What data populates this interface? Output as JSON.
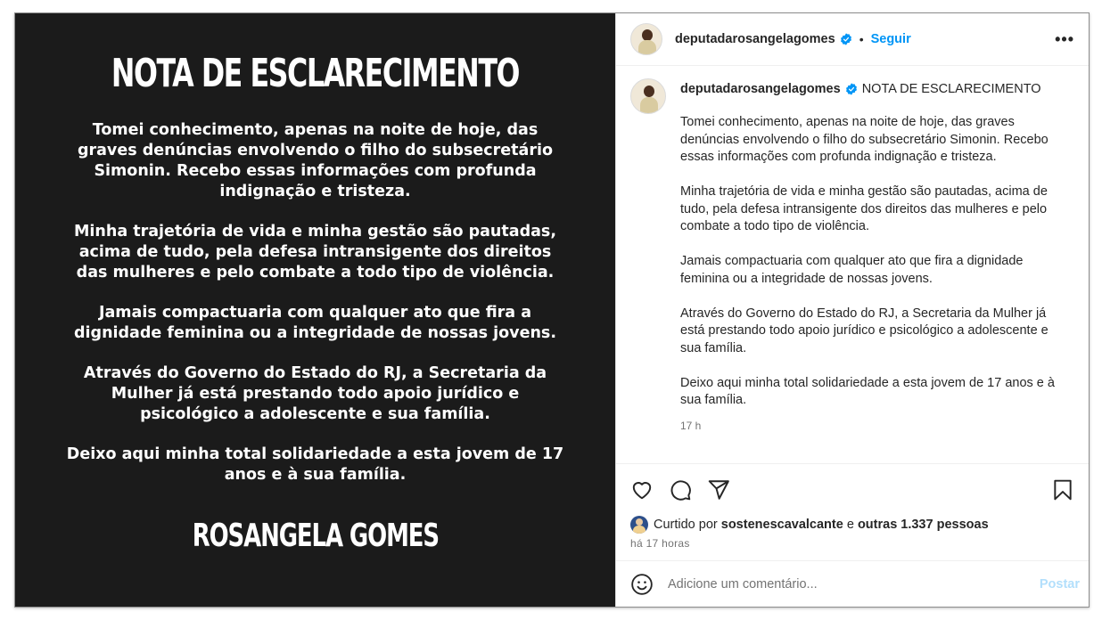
{
  "image_post": {
    "title": "NOTA DE ESCLARECIMENTO",
    "paragraphs": [
      "Tomei conhecimento, apenas na noite de hoje, das graves denúncias envolvendo o filho do subsecretário Simonin. Recebo essas informações com profunda indignação e tristeza.",
      "Minha trajetória de vida e minha gestão são pautadas, acima de tudo, pela defesa intransigente dos direitos das mulheres e pelo combate a todo tipo de violência.",
      "Jamais compactuaria com qualquer ato que fira a dignidade feminina ou a integridade de nossas jovens.",
      "Através do Governo do Estado do RJ, a Secretaria da Mulher já está prestando todo apoio jurídico e psicológico a adolescente e sua família.",
      "Deixo aqui minha total solidariedade a esta jovem de 17 anos e à sua família."
    ],
    "signature": "ROSANGELA GOMES"
  },
  "header": {
    "username": "deputadarosangelagomes",
    "separator": "•",
    "follow_label": "Seguir",
    "more_label": "•••"
  },
  "caption": {
    "username": "deputadarosangelagomes",
    "title": "NOTA DE ESCLARECIMENTO",
    "paragraphs": [
      "Tomei conhecimento, apenas na noite de hoje, das graves denúncias envolvendo o filho do subsecretário Simonin. Recebo essas informações com profunda indignação e tristeza.",
      "Minha trajetória de vida e minha gestão são pautadas, acima de tudo, pela defesa intransigente dos direitos das mulheres e pelo combate a todo tipo de violência.",
      "Jamais compactuaria com qualquer ato que fira a dignidade feminina ou a integridade de nossas jovens.",
      "Através do Governo do Estado do RJ, a Secretaria da Mulher já está prestando todo apoio jurídico e psicológico a adolescente e sua família.",
      "Deixo aqui minha total solidariedade a esta jovem de 17 anos e à sua família."
    ],
    "timestamp": "17 h"
  },
  "likes": {
    "prefix": "Curtido por",
    "liker": "sostenescavalcante",
    "conjunction": "e",
    "others": "outras 1.337 pessoas",
    "time_ago": "há 17 horas"
  },
  "comment": {
    "placeholder": "Adicione um comentário...",
    "post_label": "Postar"
  },
  "colors": {
    "accent": "#0095f6",
    "verified": "#0095f6",
    "image_bg": "#1b1b1b",
    "post_disabled": "#b2dffc"
  },
  "icons": [
    "verified-badge-icon",
    "heart-icon",
    "comment-icon",
    "share-icon",
    "bookmark-icon",
    "emoji-icon",
    "more-icon"
  ]
}
